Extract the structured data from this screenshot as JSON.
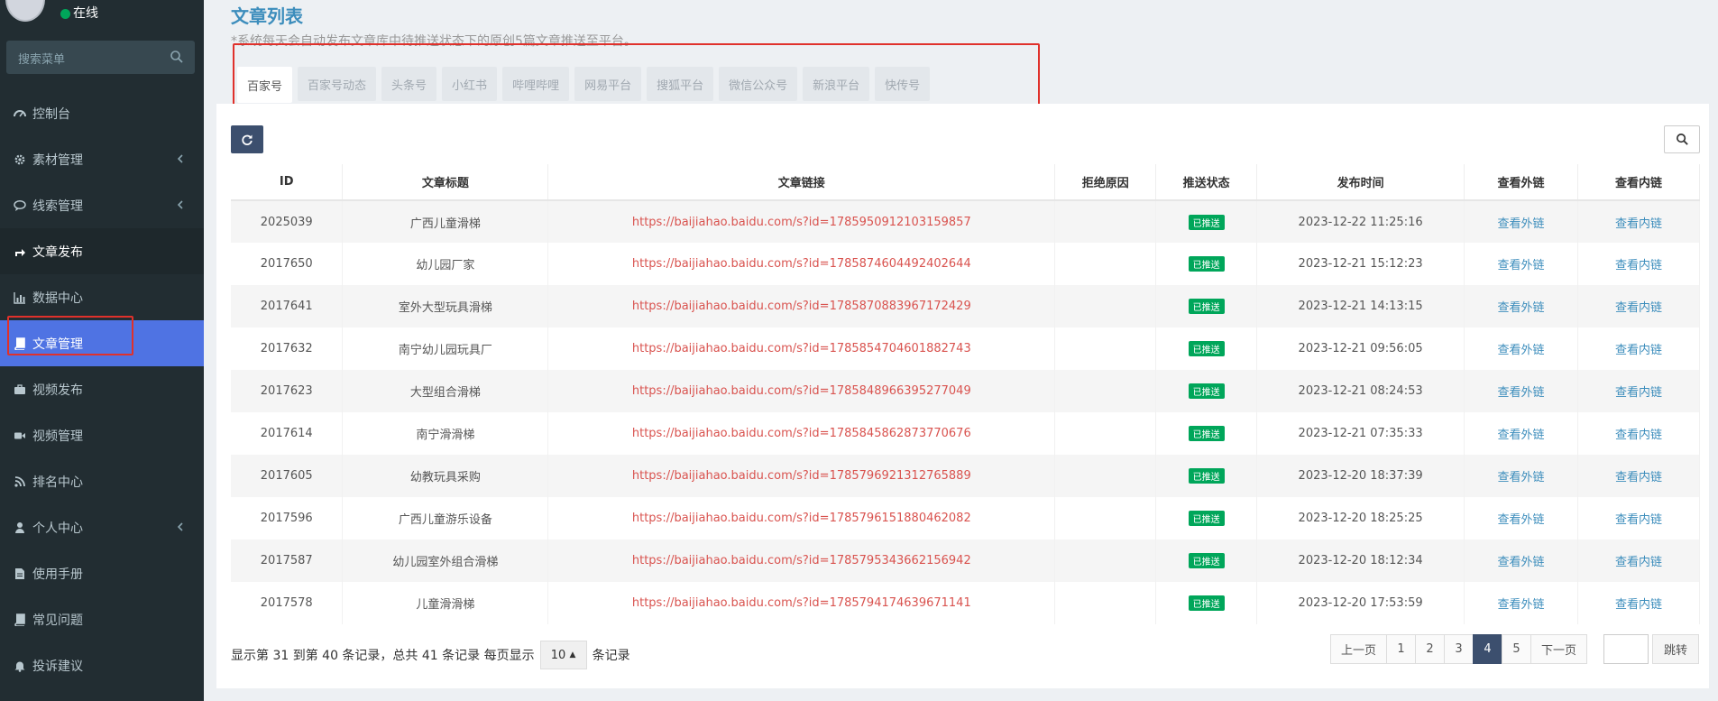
{
  "user": {
    "status": "在线"
  },
  "sidebar": {
    "search_placeholder": "搜索菜单",
    "items": [
      {
        "label": "控制台",
        "icon": "dashboard-icon"
      },
      {
        "label": "素材管理",
        "icon": "gear-icon"
      },
      {
        "label": "线索管理",
        "icon": "comment-icon"
      },
      {
        "label": "文章发布",
        "icon": "share-icon"
      },
      {
        "label": "数据中心",
        "icon": "bar-chart-icon"
      },
      {
        "label": "文章管理",
        "icon": "book-icon"
      },
      {
        "label": "视频发布",
        "icon": "briefcase-icon"
      },
      {
        "label": "视频管理",
        "icon": "video-icon"
      },
      {
        "label": "排名中心",
        "icon": "rss-icon"
      },
      {
        "label": "个人中心",
        "icon": "user-icon"
      },
      {
        "label": "使用手册",
        "icon": "file-icon"
      },
      {
        "label": "常见问题",
        "icon": "book-icon"
      },
      {
        "label": "投诉建议",
        "icon": "bell-icon"
      }
    ]
  },
  "page": {
    "title": "文章列表",
    "subtitle": "*系统每天会自动发布文章库中待推送状态下的原创5篇文章推送至平台。"
  },
  "tabs": [
    "百家号",
    "百家号动态",
    "头条号",
    "小红书",
    "哔哩哔哩",
    "网易平台",
    "搜狐平台",
    "微信公众号",
    "新浪平台",
    "快传号"
  ],
  "table": {
    "columns": [
      "ID",
      "文章标题",
      "文章链接",
      "拒绝原因",
      "推送状态",
      "发布时间",
      "查看外链",
      "查看内链"
    ],
    "rows": [
      {
        "id": "2025039",
        "title": "广西儿童滑梯",
        "link": "https://baijiahao.baidu.com/s?id=1785950912103159857",
        "reason": "",
        "status": "已推送",
        "time": "2023-12-22 11:25:16",
        "ext": "查看外链",
        "int": "查看内链"
      },
      {
        "id": "2017650",
        "title": "幼儿园厂家",
        "link": "https://baijiahao.baidu.com/s?id=1785874604492402644",
        "reason": "",
        "status": "已推送",
        "time": "2023-12-21 15:12:23",
        "ext": "查看外链",
        "int": "查看内链"
      },
      {
        "id": "2017641",
        "title": "室外大型玩具滑梯",
        "link": "https://baijiahao.baidu.com/s?id=1785870883967172429",
        "reason": "",
        "status": "已推送",
        "time": "2023-12-21 14:13:15",
        "ext": "查看外链",
        "int": "查看内链"
      },
      {
        "id": "2017632",
        "title": "南宁幼儿园玩具厂",
        "link": "https://baijiahao.baidu.com/s?id=1785854704601882743",
        "reason": "",
        "status": "已推送",
        "time": "2023-12-21 09:56:05",
        "ext": "查看外链",
        "int": "查看内链"
      },
      {
        "id": "2017623",
        "title": "大型组合滑梯",
        "link": "https://baijiahao.baidu.com/s?id=1785848966395277049",
        "reason": "",
        "status": "已推送",
        "time": "2023-12-21 08:24:53",
        "ext": "查看外链",
        "int": "查看内链"
      },
      {
        "id": "2017614",
        "title": "南宁滑滑梯",
        "link": "https://baijiahao.baidu.com/s?id=1785845862873770676",
        "reason": "",
        "status": "已推送",
        "time": "2023-12-21 07:35:33",
        "ext": "查看外链",
        "int": "查看内链"
      },
      {
        "id": "2017605",
        "title": "幼教玩具采购",
        "link": "https://baijiahao.baidu.com/s?id=1785796921312765889",
        "reason": "",
        "status": "已推送",
        "time": "2023-12-20 18:37:39",
        "ext": "查看外链",
        "int": "查看内链"
      },
      {
        "id": "2017596",
        "title": "广西儿童游乐设备",
        "link": "https://baijiahao.baidu.com/s?id=1785796151880462082",
        "reason": "",
        "status": "已推送",
        "time": "2023-12-20 18:25:25",
        "ext": "查看外链",
        "int": "查看内链"
      },
      {
        "id": "2017587",
        "title": "幼儿园室外组合滑梯",
        "link": "https://baijiahao.baidu.com/s?id=1785795343662156942",
        "reason": "",
        "status": "已推送",
        "time": "2023-12-20 18:12:34",
        "ext": "查看外链",
        "int": "查看内链"
      },
      {
        "id": "2017578",
        "title": "儿童滑滑梯",
        "link": "https://baijiahao.baidu.com/s?id=1785794174639671141",
        "reason": "",
        "status": "已推送",
        "time": "2023-12-20 17:53:59",
        "ext": "查看外链",
        "int": "查看内链"
      }
    ]
  },
  "footer": {
    "info_prefix": "显示第 31 到第 40 条记录，总共 41 条记录 每页显示",
    "page_size": "10",
    "info_suffix": "条记录"
  },
  "pager": {
    "prev": "上一页",
    "pages": [
      "1",
      "2",
      "3",
      "4",
      "5"
    ],
    "active_page": "4",
    "next": "下一页",
    "jump": "跳转"
  },
  "colors": {
    "sidebar_bg": "#222d32",
    "active_blue": "#4f73e3",
    "link_red": "#d9534f",
    "link_blue": "#3c8dbc",
    "badge_green": "#00a65a",
    "highlight_red": "#e0312b"
  }
}
